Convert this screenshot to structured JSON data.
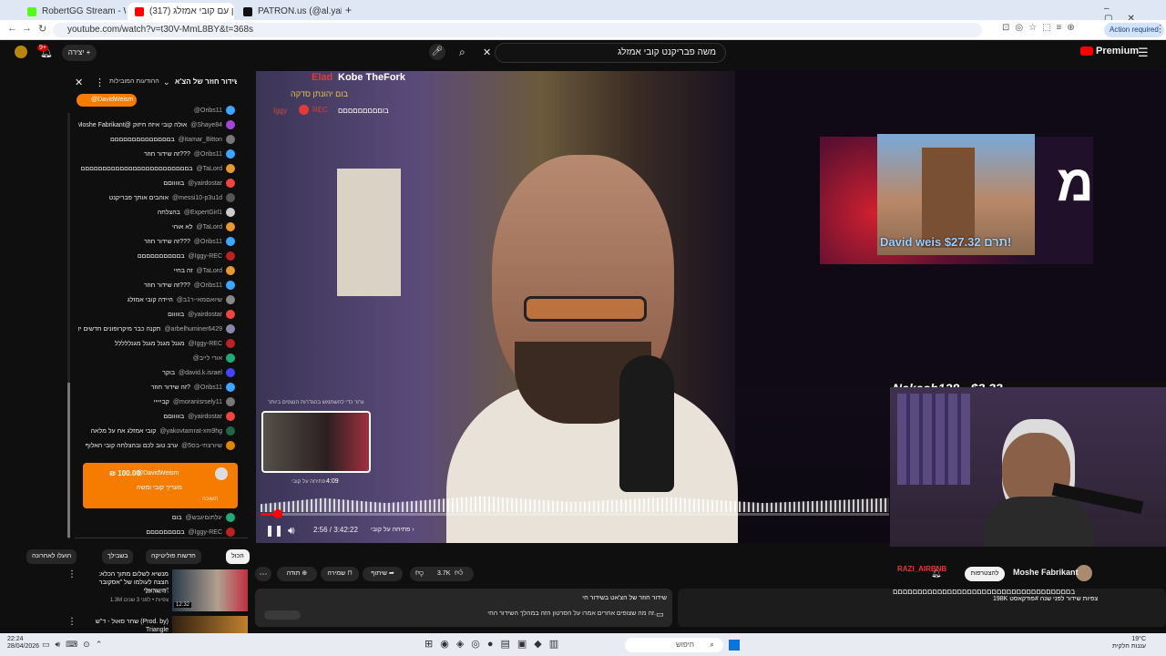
{
  "tabs": [
    {
      "label": "RobertGG Stream - Watch Live",
      "color": "#53fc18"
    },
    {
      "label": "(317) הראיון עם קובי אמזלג",
      "color": "#ff0000"
    },
    {
      "label": "PATRON.us (@al.yahud) | Ti",
      "color": "#111111"
    }
  ],
  "url": "youtube.com/watch?v=t30V-MmL8BY&t=368s",
  "update_label": "Action required",
  "header": {
    "search_value": "משה פבריקנט קובי אמזלג",
    "premium_label": "Premium",
    "create_label": "יצירה",
    "notif_count": "9+"
  },
  "chat": {
    "title": "שידור חוזר של הצ'א...",
    "subtitle": "ההודעות המובילות",
    "pinned": "@DavidWeism",
    "messages": [
      {
        "user": "@Oribs11",
        "text": "",
        "color": "#3ea6ff"
      },
      {
        "user": "@Shaye84",
        "text": "Moshe Fabrikant@ אולה קובי איזה חיזוק",
        "color": "#a447d8"
      },
      {
        "user": "@itamar_Bitton",
        "text": "בםםםםםםםםםםםםםם",
        "color": "#777"
      },
      {
        "user": "@Oribs11",
        "text": "זה שידור חוזר???",
        "color": "#3ea6ff"
      },
      {
        "user": "@TaLord",
        "text": "בםםםםםםםםםםםםםםםםםםםםםםםםם",
        "color": "#e59933"
      },
      {
        "user": "@yairdostar",
        "text": "בוווווםם",
        "color": "#e44"
      },
      {
        "user": "@messi10-p3u1d",
        "text": "אוהבים אותך פבריקנט",
        "color": "#555"
      },
      {
        "user": "@ExpertGirl1",
        "text": "בהצלחה",
        "color": "#ccc"
      },
      {
        "user": "@TaLord",
        "text": "לא אוהי",
        "color": "#e59933"
      },
      {
        "user": "@Oribs11",
        "text": "זה שידור חוזר???",
        "color": "#3ea6ff"
      },
      {
        "user": "@Iggy-REC",
        "text": "בםםםםםםםםםם",
        "color": "#b22"
      },
      {
        "user": "@TaLord",
        "text": "זה בחיי",
        "color": "#e59933"
      },
      {
        "user": "@Oribs11",
        "text": "זה שידור חוזר???",
        "color": "#3ea6ff"
      },
      {
        "user": "@שיואםמאי-ר1ב",
        "text": "היידה קובי אמזלג",
        "color": "#888"
      },
      {
        "user": "@yairdostar",
        "text": "בווווום",
        "color": "#e44"
      },
      {
        "user": "@arbelhuminer6429",
        "text": "תקנה כבר מיקרופונים חדשים יזנות",
        "color": "#88a"
      },
      {
        "user": "@Iggy-REC",
        "text": "מגנל מגנל מגנל מגנללללל",
        "color": "#b22"
      },
      {
        "user": "@אורי לייב",
        "text": "",
        "color": "#2a7"
      },
      {
        "user": "@david.k.israel",
        "text": "בוקר",
        "color": "#44f"
      },
      {
        "user": "@Oribs11",
        "text": "זה שידור חוזר?",
        "color": "#3ea6ff"
      },
      {
        "user": "@moranisrsely11",
        "text": "קבייייי",
        "color": "#777"
      },
      {
        "user": "@yairdostar",
        "text": "בוווווםם",
        "color": "#e44"
      },
      {
        "user": "@yakovtamrat-xm9hg",
        "text": "קובי אמזלג אח על מלאה",
        "color": "#264"
      },
      {
        "user": "@שיורצחי-בס5",
        "text": "ערב טוב לכם ובהצלחה קובי האלוף",
        "color": "#d80"
      }
    ],
    "superchat": {
      "user": "@DavidWeism",
      "amount": "₪ 100.00",
      "text": "מעריך קובי ומשה",
      "reply": "תשובה"
    },
    "after": [
      {
        "user": "@יגלתוםיגבש",
        "text": "בום",
        "color": "#2a7"
      },
      {
        "user": "@Iggy-REC",
        "text": "בםםםםםםםם",
        "color": "#b22"
      }
    ]
  },
  "video": {
    "overlay_names": [
      "Elad",
      "Kobe TheFork"
    ],
    "overlay_line2": "בום יהונתן סדקה",
    "overlay_line3": "בוםםםםםםםםם",
    "rec_label": "REC",
    "iggy_label": "Iggy",
    "donation": "David weis תרם $27.32!",
    "nakash": "Nakash128 - $3.33",
    "time": "2:56 / 3:42:22",
    "chapter": "פתיחה על קובי",
    "preview_time": "4:09",
    "preview_label": "פתיחה על קובי",
    "preview_hint": "גרור כדי להשתמש בהגדרות הנצפים ביותר"
  },
  "below": {
    "filters": [
      "הכול",
      "חדשות פוליטיקה",
      "בשבילך",
      "הועלו לאחרונה"
    ],
    "channel": "Moshe Fabrikant",
    "subscribe": "להצטרפות",
    "likes": "3.7K",
    "share": "שיתוף",
    "save": "שמירה",
    "thanks": "תודה",
    "desc1": "שידור חוזר של הצ'אט בשידור חי",
    "desc2": "זה מה שצופים אחרים אמרו על הסרטון הזה במהלך השידור החי.",
    "views": "198K צפיות  שידור לפני שנה  #פודקאסט",
    "rec1_title": "מנשיא לשלום מתוך הכלא: הצצה לעולמו של \"אסקובר הישראלי\"",
    "rec1_channel": "חדשות 13",
    "rec1_meta": "1.3M צפיות • לפני 3 שנים",
    "rec1_duration": "12:32",
    "rec2_title": "שחר סאול - ד\"ש (Prod. by) Triangle",
    "comment_user": "RAZI_AIRBNB",
    "comment_text": "בםםםםםםםםםםםםםםםםםםםםםםםםםםםםםםםםםםםם"
  },
  "taskbar": {
    "time": "22:24",
    "date": "28/04/2026",
    "search": "חיפוש",
    "temp": "19°C",
    "weather": "עננות חלקית"
  }
}
